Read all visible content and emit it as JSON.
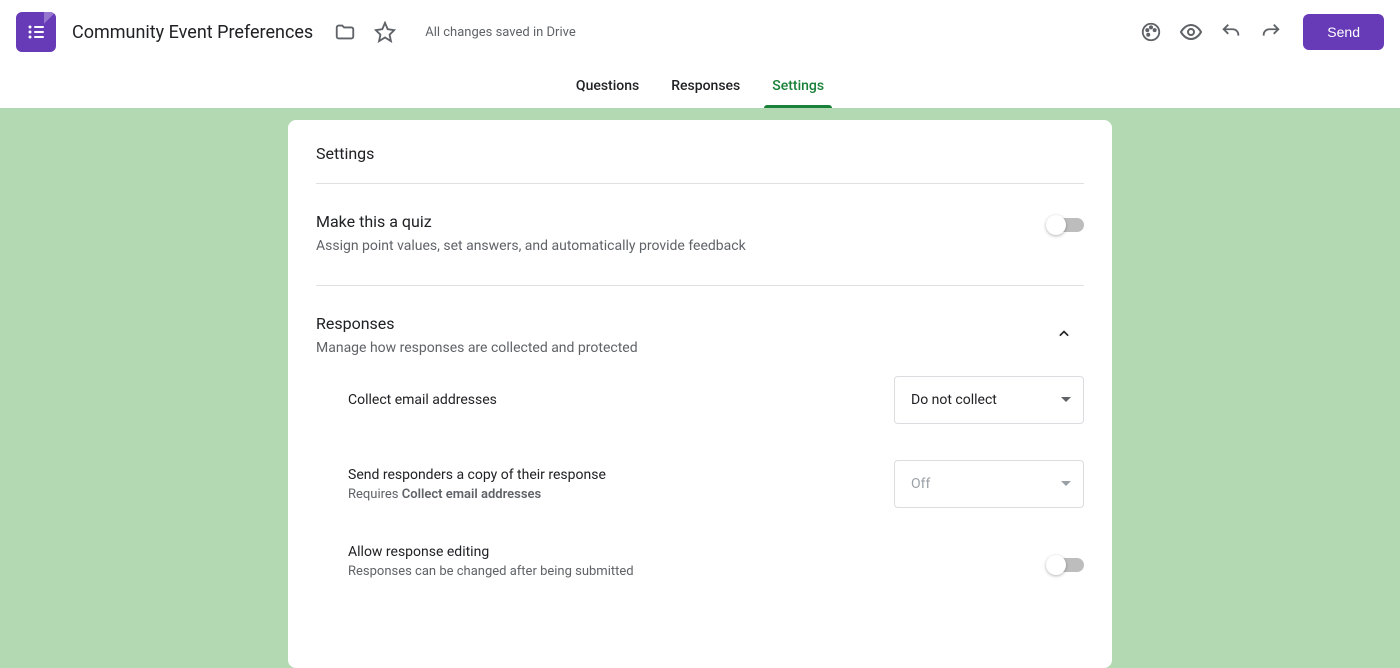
{
  "header": {
    "form_title": "Community Event Preferences",
    "save_status": "All changes saved in Drive",
    "send_label": "Send"
  },
  "tabs": {
    "questions": "Questions",
    "responses": "Responses",
    "settings": "Settings",
    "active": "settings"
  },
  "settings": {
    "page_title": "Settings",
    "quiz": {
      "title": "Make this a quiz",
      "desc": "Assign point values, set answers, and automatically provide feedback",
      "enabled": false
    },
    "responses": {
      "title": "Responses",
      "desc": "Manage how responses are collected and protected",
      "expanded": true,
      "collect_email": {
        "label": "Collect email addresses",
        "value": "Do not collect"
      },
      "send_copy": {
        "label": "Send responders a copy of their response",
        "requires_prefix": "Requires ",
        "requires_bold": "Collect email addresses",
        "value": "Off",
        "disabled": true
      },
      "allow_edit": {
        "label": "Allow response editing",
        "desc": "Responses can be changed after being submitted",
        "enabled": false
      }
    }
  }
}
